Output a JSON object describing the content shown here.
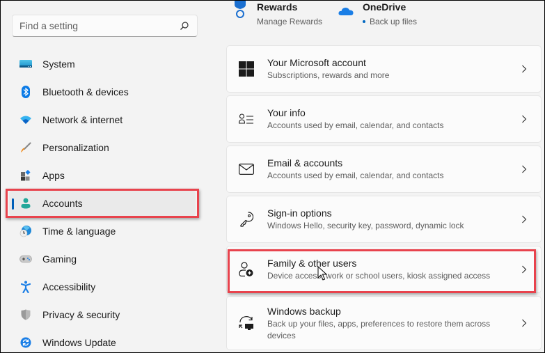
{
  "search": {
    "placeholder": "Find a setting"
  },
  "sidebar": {
    "items": [
      {
        "label": "System",
        "icon": "system-icon"
      },
      {
        "label": "Bluetooth & devices",
        "icon": "bluetooth-icon"
      },
      {
        "label": "Network & internet",
        "icon": "wifi-icon"
      },
      {
        "label": "Personalization",
        "icon": "paintbrush-icon"
      },
      {
        "label": "Apps",
        "icon": "apps-icon"
      },
      {
        "label": "Accounts",
        "icon": "person-icon",
        "active": true
      },
      {
        "label": "Time & language",
        "icon": "clock-globe-icon"
      },
      {
        "label": "Gaming",
        "icon": "gamepad-icon"
      },
      {
        "label": "Accessibility",
        "icon": "accessibility-icon"
      },
      {
        "label": "Privacy & security",
        "icon": "shield-icon"
      },
      {
        "label": "Windows Update",
        "icon": "update-icon"
      }
    ]
  },
  "tiles": [
    {
      "title": "Rewards",
      "subtitle": "Manage Rewards",
      "icon": "medal-icon"
    },
    {
      "title": "OneDrive",
      "subtitle": "Back up files",
      "icon": "cloud-icon"
    }
  ],
  "cards": [
    {
      "title": "Your Microsoft account",
      "subtitle": "Subscriptions, rewards and more",
      "icon": "windows-logo-icon"
    },
    {
      "title": "Your info",
      "subtitle": "Accounts used by email, calendar, and contacts",
      "icon": "person-list-icon"
    },
    {
      "title": "Email & accounts",
      "subtitle": "Accounts used by email, calendar, and contacts",
      "icon": "mail-icon"
    },
    {
      "title": "Sign-in options",
      "subtitle": "Windows Hello, security key, password, dynamic lock",
      "icon": "key-icon"
    },
    {
      "title": "Family & other users",
      "subtitle": "Device access, work or school users, kiosk assigned access",
      "icon": "person-add-icon"
    },
    {
      "title": "Windows backup",
      "subtitle": "Back up your files, apps, preferences to restore them across devices",
      "icon": "backup-icon"
    }
  ],
  "colors": {
    "accent": "#005fb8",
    "highlight": "#e8434d",
    "background": "#f3f3f3",
    "card": "#fbfbfb"
  }
}
